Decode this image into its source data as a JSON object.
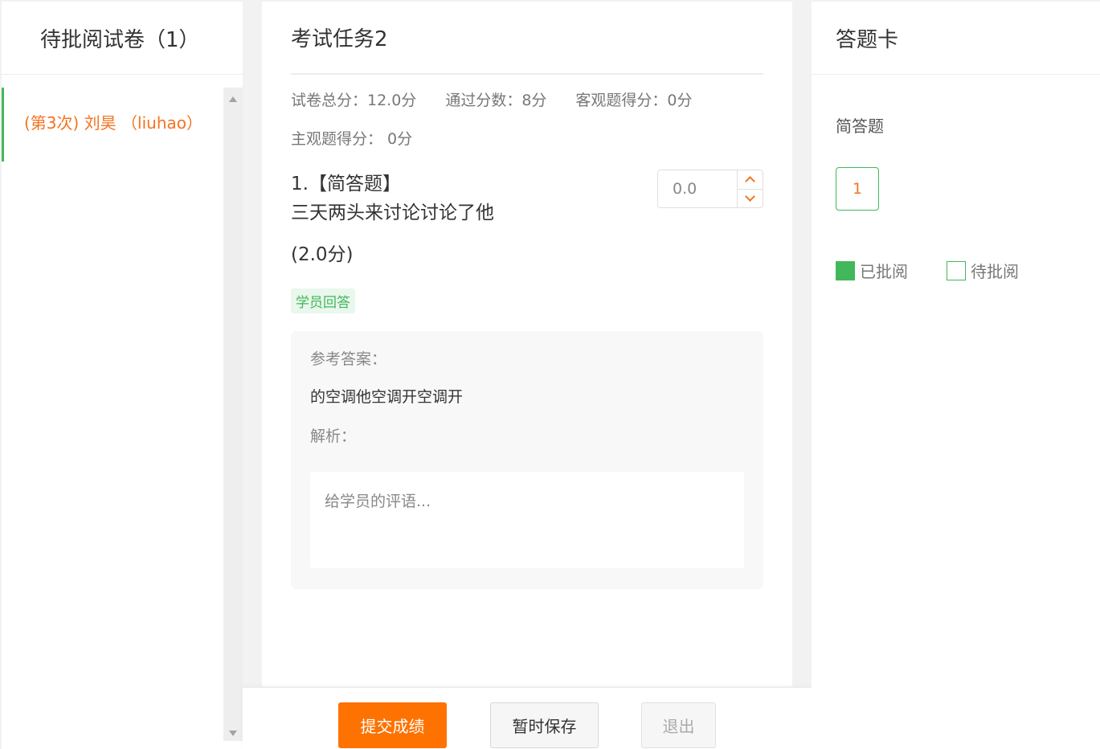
{
  "left": {
    "header": "待批阅试卷（1）",
    "items": [
      {
        "label": "(第3次) 刘昊 （liuhao）"
      }
    ]
  },
  "center": {
    "title": "考试任务2",
    "scores": {
      "total": "试卷总分：12.0分",
      "pass": "通过分数：8分",
      "objective": "客观题得分：0分",
      "subjective": "主观题得分： 0分"
    },
    "question": {
      "heading": "1.【简答题】",
      "text": "三天两头来讨论讨论了他",
      "points": "(2.0分)",
      "score_value": "0.0",
      "tag": "学员回答",
      "answer_label": "参考答案：",
      "answer_text": "的空调他空调开空调开",
      "analysis_label": "解析：",
      "comment_placeholder": "给学员的评语..."
    }
  },
  "actions": {
    "submit": "提交成绩",
    "save": "暂时保存",
    "exit": "退出"
  },
  "right": {
    "header": "答题卡",
    "section": "简答题",
    "cards": [
      "1"
    ],
    "legend_done": "已批阅",
    "legend_pending": "待批阅"
  },
  "colors": {
    "accent": "#fd7200",
    "highlight_text": "#f47321",
    "success": "#43b75c"
  }
}
